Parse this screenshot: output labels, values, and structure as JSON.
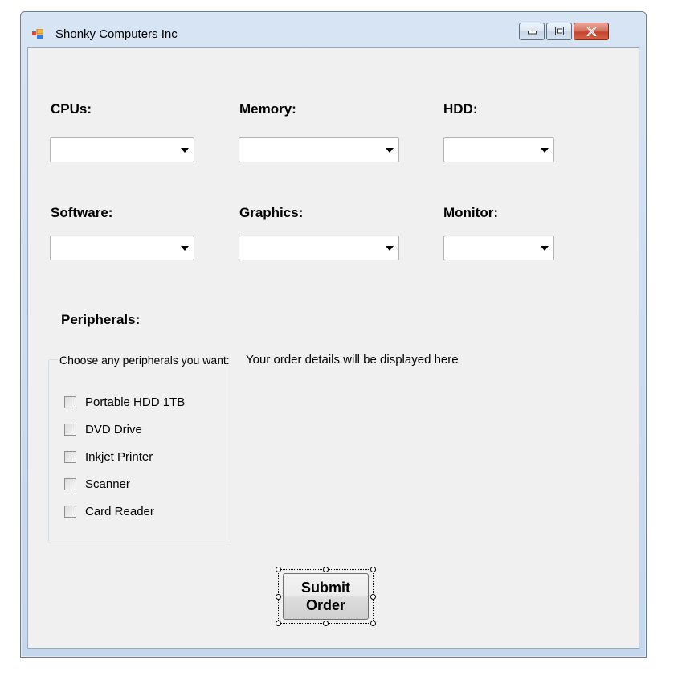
{
  "window": {
    "title": "Shonky Computers Inc",
    "icons": {
      "app": "windows-forms-app-icon",
      "minimize": "minimize-icon",
      "maximize": "maximize-icon",
      "close": "close-icon"
    }
  },
  "form": {
    "labels": {
      "cpus": "CPUs:",
      "memory": "Memory:",
      "hdd": "HDD:",
      "software": "Software:",
      "graphics": "Graphics:",
      "monitor": "Monitor:",
      "peripherals": "Peripherals:"
    },
    "combos": {
      "cpus": "",
      "memory": "",
      "hdd": "",
      "software": "",
      "graphics": "",
      "monitor": ""
    },
    "peripherals_group": {
      "caption": "Choose any peripherals you want:",
      "items": [
        {
          "label": "Portable HDD 1TB",
          "checked": false
        },
        {
          "label": "DVD Drive",
          "checked": false
        },
        {
          "label": "Inkjet Printer",
          "checked": false
        },
        {
          "label": "Scanner",
          "checked": false
        },
        {
          "label": "Card Reader",
          "checked": false
        }
      ]
    },
    "order_details_text": "Your order details will be displayed here",
    "submit_label": "Submit\nOrder"
  }
}
